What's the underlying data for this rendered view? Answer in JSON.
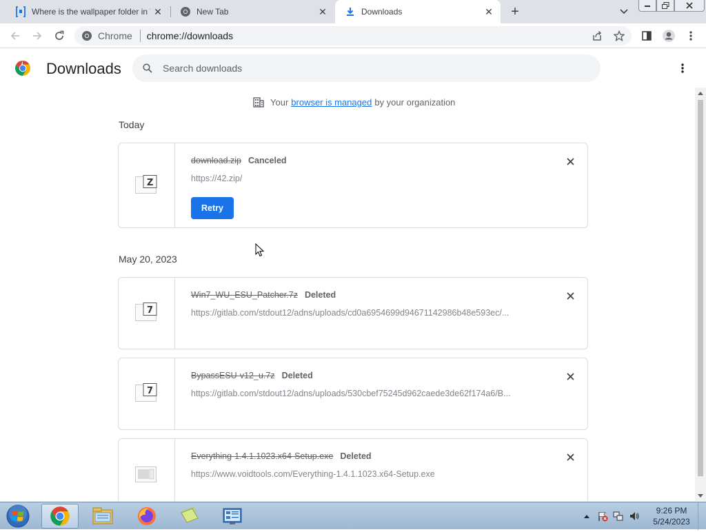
{
  "tabs": [
    {
      "title": "Where is the wallpaper folder in W",
      "icon": "site-favicon-icon",
      "active": false
    },
    {
      "title": "New Tab",
      "icon": "chrome-favicon-icon",
      "active": false
    },
    {
      "title": "Downloads",
      "icon": "download-icon",
      "active": true
    }
  ],
  "toolbar": {
    "site_chip": "Chrome",
    "url": "chrome://downloads"
  },
  "page": {
    "title": "Downloads",
    "search_placeholder": "Search downloads"
  },
  "managed": {
    "prefix": "Your",
    "link": "browser is managed",
    "suffix": "by your organization"
  },
  "groups": [
    {
      "date": "Today",
      "items": [
        {
          "filename": "download.zip",
          "status": "Canceled",
          "url": "https://42.zip/",
          "icon": "zip-file-icon",
          "icon_glyph": "Z",
          "action": "Retry"
        }
      ]
    },
    {
      "date": "May 20, 2023",
      "items": [
        {
          "filename": "Win7_WU_ESU_Patcher.7z",
          "status": "Deleted",
          "url": "https://gitlab.com/stdout12/adns/uploads/cd0a6954699d94671142986b48e593ec/...",
          "icon": "7z-file-icon",
          "icon_glyph": "7"
        },
        {
          "filename": "BypassESU-v12_u.7z",
          "status": "Deleted",
          "url": "https://gitlab.com/stdout12/adns/uploads/530cbef75245d962caede3de62f174a6/B...",
          "icon": "7z-file-icon",
          "icon_glyph": "7"
        },
        {
          "filename": "Everything-1.4.1.1023.x64-Setup.exe",
          "status": "Deleted",
          "url": "https://www.voidtools.com/Everything-1.4.1.1023.x64-Setup.exe",
          "icon": "exe-file-icon",
          "icon_glyph": ""
        }
      ]
    }
  ],
  "taskbar": {
    "time": "9:26 PM",
    "date": "5/24/2023"
  },
  "colors": {
    "accent": "#1a73e8",
    "tabstrip": "#dee1e6",
    "taskbar": "#a9c2dc"
  }
}
